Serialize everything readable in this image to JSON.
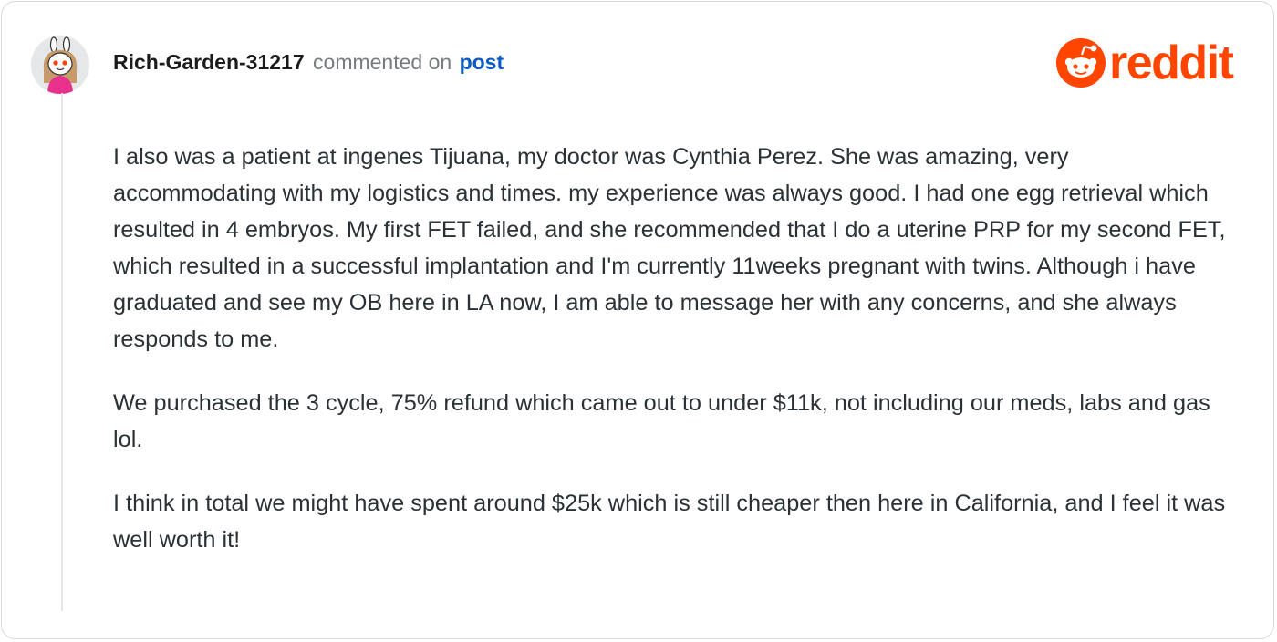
{
  "comment": {
    "username": "Rich-Garden-31217",
    "action_text": "commented on",
    "post_link_label": "post",
    "paragraphs": [
      "I also was a patient at ingenes Tijuana, my doctor was Cynthia Perez. She was amazing, very accommodating with my logistics and times. my experience was always good. I had one egg retrieval which resulted in 4 embryos. My first FET failed, and she recommended that I do a uterine PRP for my second FET, which resulted in a successful implantation and I'm currently 11weeks pregnant with twins. Although i have graduated and see my OB here in LA now, I am able to message her with any concerns, and she always responds to me.",
      "We purchased the 3 cycle, 75% refund which came out to under $11k, not including our meds, labs and gas lol.",
      "I think in total we might have spent around $25k which is still cheaper then here in California, and I feel it was well worth it!"
    ]
  },
  "brand": {
    "wordmark": "reddit",
    "icon": "reddit-snoo-icon",
    "color": "#ff4500"
  },
  "avatar": {
    "icon": "user-avatar-icon"
  },
  "colors": {
    "username": "#1c1c1c",
    "muted": "#787c7e",
    "link": "#0a5bc4",
    "body_text": "#2a3236",
    "thread_line": "#e3e5e8"
  }
}
